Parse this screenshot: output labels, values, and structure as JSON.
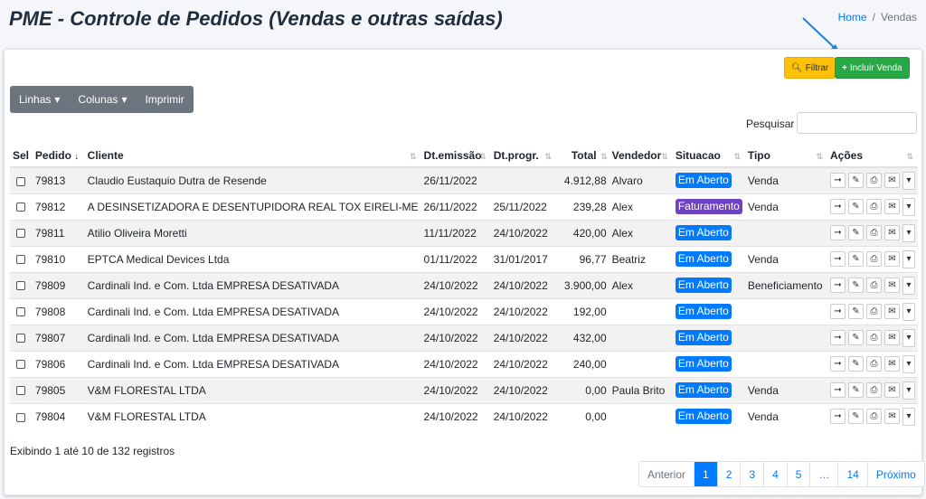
{
  "page": {
    "title": "PME - Controle de Pedidos (Vendas e outras saídas)"
  },
  "breadcrumb": {
    "home": "Home",
    "sep": "/",
    "current": "Vendas"
  },
  "toolbar": {
    "filtrar": "Filtrar",
    "incluir": "Incluir Venda"
  },
  "group": {
    "linhas": "Linhas",
    "colunas": "Colunas",
    "imprimir": "Imprimir"
  },
  "search": {
    "label": "Pesquisar",
    "value": ""
  },
  "table": {
    "headers": {
      "sel": "Sel",
      "pedido": "Pedido",
      "cliente": "Cliente",
      "emissao": "Dt.emissão",
      "progr": "Dt.progr.",
      "total": "Total",
      "vendedor": "Vendedor",
      "situacao": "Situacao",
      "tipo": "Tipo",
      "acoes": "Ações"
    },
    "rows": [
      {
        "pedido": "79813",
        "cliente": "Claudio Eustaquio Dutra de Resende",
        "emissao": "26/11/2022",
        "progr": "",
        "total": "4.912,88",
        "vendedor": "Alvaro",
        "situacao": "Em Aberto",
        "tipo": "Venda"
      },
      {
        "pedido": "79812",
        "cliente": "A DESINSETIZADORA E DESENTUPIDORA REAL TOX EIRELI-ME",
        "emissao": "26/11/2022",
        "progr": "25/11/2022",
        "total": "239,28",
        "vendedor": "Alex",
        "situacao": "Faturamento",
        "tipo": "Venda"
      },
      {
        "pedido": "79811",
        "cliente": "Atilio Oliveira Moretti",
        "emissao": "11/11/2022",
        "progr": "24/10/2022",
        "total": "420,00",
        "vendedor": "Alex",
        "situacao": "Em Aberto",
        "tipo": ""
      },
      {
        "pedido": "79810",
        "cliente": "EPTCA Medical Devices Ltda",
        "emissao": "01/11/2022",
        "progr": "31/01/2017",
        "total": "96,77",
        "vendedor": "Beatriz",
        "situacao": "Em Aberto",
        "tipo": "Venda"
      },
      {
        "pedido": "79809",
        "cliente": "Cardinali Ind. e Com. Ltda EMPRESA DESATIVADA",
        "emissao": "24/10/2022",
        "progr": "24/10/2022",
        "total": "3.900,00",
        "vendedor": "Alex",
        "situacao": "Em Aberto",
        "tipo": "Beneficiamento"
      },
      {
        "pedido": "79808",
        "cliente": "Cardinali Ind. e Com. Ltda EMPRESA DESATIVADA",
        "emissao": "24/10/2022",
        "progr": "24/10/2022",
        "total": "192,00",
        "vendedor": "",
        "situacao": "Em Aberto",
        "tipo": ""
      },
      {
        "pedido": "79807",
        "cliente": "Cardinali Ind. e Com. Ltda EMPRESA DESATIVADA",
        "emissao": "24/10/2022",
        "progr": "24/10/2022",
        "total": "432,00",
        "vendedor": "",
        "situacao": "Em Aberto",
        "tipo": ""
      },
      {
        "pedido": "79806",
        "cliente": "Cardinali Ind. e Com. Ltda EMPRESA DESATIVADA",
        "emissao": "24/10/2022",
        "progr": "24/10/2022",
        "total": "240,00",
        "vendedor": "",
        "situacao": "Em Aberto",
        "tipo": ""
      },
      {
        "pedido": "79805",
        "cliente": "V&M FLORESTAL LTDA",
        "emissao": "24/10/2022",
        "progr": "24/10/2022",
        "total": "0,00",
        "vendedor": "Paula Brito",
        "situacao": "Em Aberto",
        "tipo": "Venda"
      },
      {
        "pedido": "79804",
        "cliente": "V&M FLORESTAL LTDA",
        "emissao": "24/10/2022",
        "progr": "24/10/2022",
        "total": "0,00",
        "vendedor": "",
        "situacao": "Em Aberto",
        "tipo": "Venda"
      }
    ]
  },
  "info": "Exibindo 1 até 10 de 132 registros",
  "pagination": [
    "Anterior",
    "1",
    "2",
    "3",
    "4",
    "5",
    "…",
    "14",
    "Próximo"
  ],
  "colors": {
    "badge_open": "#007bff",
    "badge_billing": "#6f42c1",
    "accent_green": "#28a745",
    "accent_yellow": "#ffc107",
    "arrow": "#1e7fd6"
  }
}
